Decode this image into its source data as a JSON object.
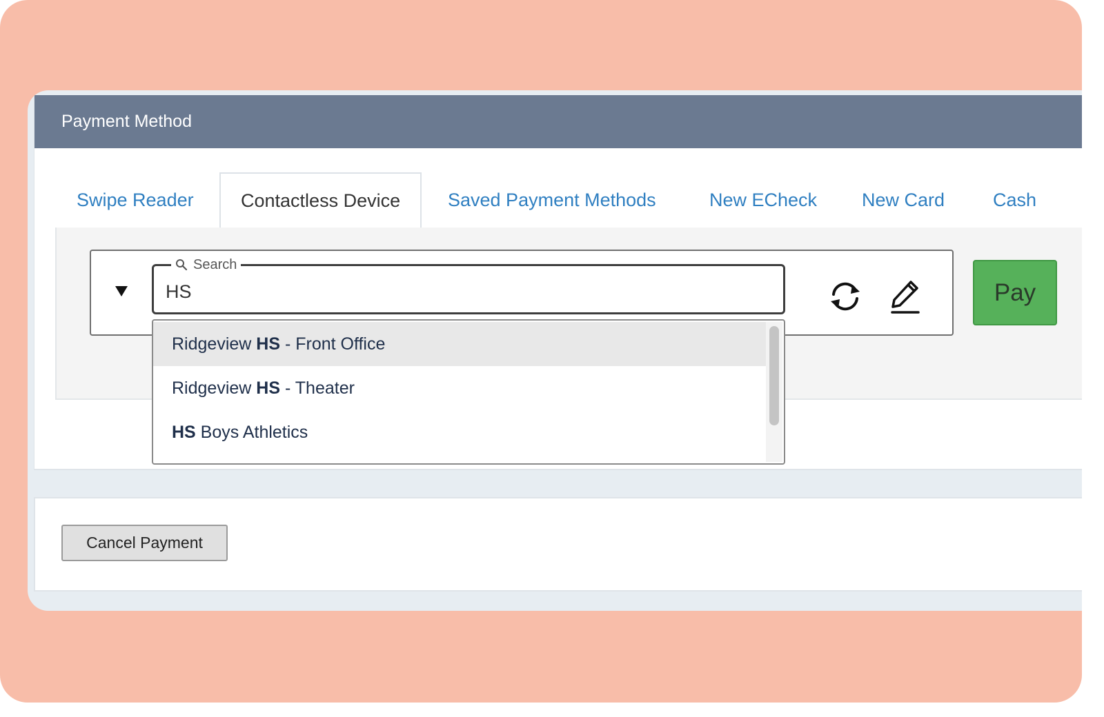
{
  "header": {
    "title": "Payment Method"
  },
  "tabs": [
    {
      "label": "Swipe Reader",
      "active": false
    },
    {
      "label": "Contactless Device",
      "active": true
    },
    {
      "label": "Saved Payment Methods",
      "active": false
    },
    {
      "label": "New ECheck",
      "active": false
    },
    {
      "label": "New Card",
      "active": false
    },
    {
      "label": "Cash",
      "active": false
    }
  ],
  "search": {
    "legend": "Search",
    "value": "HS",
    "icon": "search-icon"
  },
  "dropdown": {
    "items": [
      {
        "pre": "Ridgeview ",
        "match": "HS",
        "post": " - Front Office",
        "highlighted": true
      },
      {
        "pre": "Ridgeview ",
        "match": "HS",
        "post": " - Theater",
        "highlighted": false
      },
      {
        "pre": "",
        "match": "HS",
        "post": " Boys Athletics",
        "highlighted": false
      }
    ]
  },
  "icons": {
    "toggle": "triangle-down-icon",
    "refresh": "refresh-icon",
    "edit": "pencil-icon"
  },
  "actions": {
    "pay_label": "Pay",
    "cancel_label": "Cancel Payment"
  },
  "colors": {
    "header": "#6b7a91",
    "tab_link": "#2f7fc1",
    "pay": "#56b15a",
    "background": "#f8bda9"
  }
}
